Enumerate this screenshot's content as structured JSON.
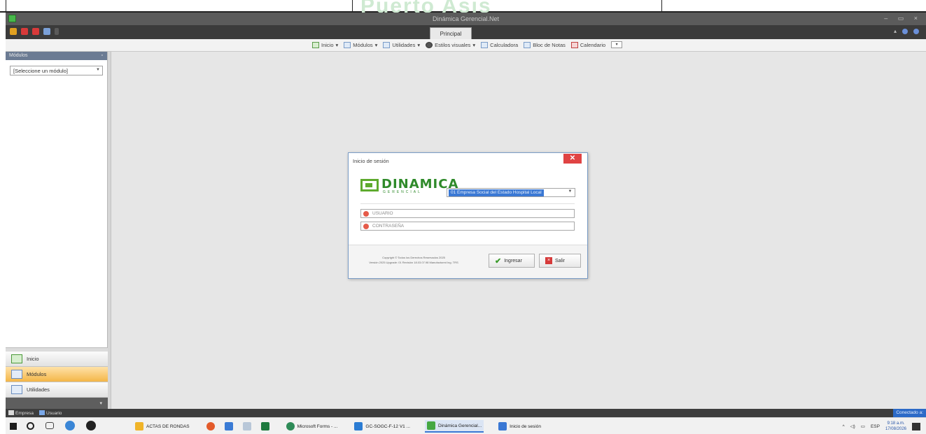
{
  "watermark": "Puerto Asis",
  "window": {
    "title": "Dinámica Gerencial.Net",
    "controls": "– ▭ ×"
  },
  "ribbon": {
    "active_tab": "Principal"
  },
  "toolbar": {
    "items": [
      {
        "label": "Inicio",
        "icon": "home-icon"
      },
      {
        "label": "Módulos",
        "icon": "modules-icon"
      },
      {
        "label": "Utilidades",
        "icon": "utilities-icon"
      },
      {
        "label": "Estilos visuales",
        "icon": "styles-icon"
      },
      {
        "label": "Calculadora",
        "icon": "calculator-icon"
      },
      {
        "label": "Bloc de Notas",
        "icon": "notepad-icon"
      },
      {
        "label": "Calendario",
        "icon": "calendar-icon"
      }
    ]
  },
  "left_panel": {
    "header": "Módulos",
    "pin": "▫",
    "module_select_value": "[Seleccione un módulo]",
    "nav": [
      {
        "label": "Inicio",
        "icon": "home-icon",
        "active": false
      },
      {
        "label": "Módulos",
        "icon": "modules-icon",
        "active": true
      },
      {
        "label": "Utilidades",
        "icon": "utilities-icon",
        "active": false
      }
    ]
  },
  "dialog": {
    "title": "Inicio de sesión",
    "close": "✕",
    "logo_word": "DINAMICA",
    "logo_sub": "GERENCIAL",
    "company": "01 Empresa Social del Estado Hospital Local",
    "username_placeholder": "USUARIO",
    "password_placeholder": "CONTRASEÑA",
    "copyright_line1": "Copyright © Todos los Derechos Reservados 2025",
    "copyright_line2": "Versión 2025 Upgrade: 01 Revisión 18.03.07.98 Manufactured Ing. TRS",
    "login_button": "Ingresar",
    "exit_button": "Salir"
  },
  "statusbar": {
    "company_label": "Empresa",
    "user_label": "Usuario",
    "right_label": "Conectado a:"
  },
  "taskbar": {
    "apps": [
      {
        "label": "ACTAS DE RONDAS",
        "color": "#f0b429"
      },
      {
        "label": "Microsoft Forms - ...",
        "color": "#2e8b57"
      },
      {
        "label": "GC-SOGC-F-12 V1 ...",
        "color": "#2b7cd3"
      },
      {
        "label": "Dinámica Gerencial...",
        "color": "#46a843"
      },
      {
        "label": "Inicio de sesión",
        "color": "#3a78d4"
      }
    ],
    "tray_lang": "ESP",
    "time": "9:18 a.m.",
    "date": "17/08/2026"
  }
}
